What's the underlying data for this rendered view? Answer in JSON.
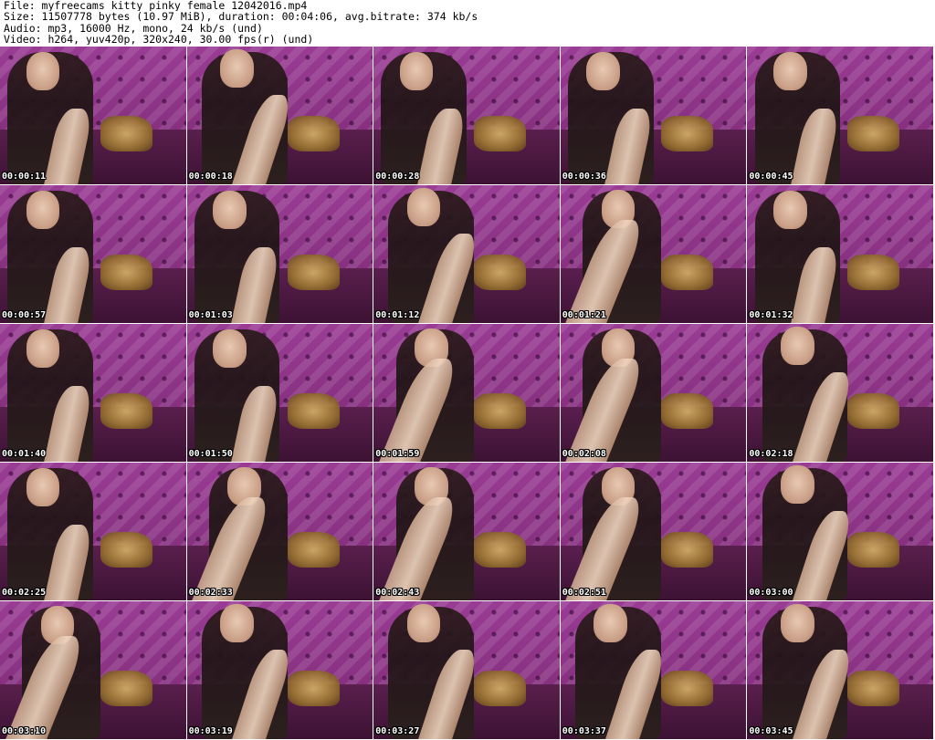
{
  "header": {
    "file_line": "File: myfreecams_kitty_pinky_female_12042016.mp4",
    "size_line": "Size: 11507778 bytes (10.97 MiB), duration: 00:04:06, avg.bitrate: 374 kb/s",
    "audio_line": "Audio: mp3, 16000 Hz, mono, 24 kb/s (und)",
    "video_line": "Video: h264, yuv420p, 320x240, 30.00 fps(r) (und)"
  },
  "thumbnails": [
    {
      "timestamp": "00:00:11"
    },
    {
      "timestamp": "00:00:18"
    },
    {
      "timestamp": "00:00:28"
    },
    {
      "timestamp": "00:00:36"
    },
    {
      "timestamp": "00:00:45"
    },
    {
      "timestamp": "00:00:57"
    },
    {
      "timestamp": "00:01:03"
    },
    {
      "timestamp": "00:01:12"
    },
    {
      "timestamp": "00:01:21"
    },
    {
      "timestamp": "00:01:32"
    },
    {
      "timestamp": "00:01:40"
    },
    {
      "timestamp": "00:01:50"
    },
    {
      "timestamp": "00:01:59"
    },
    {
      "timestamp": "00:02:08"
    },
    {
      "timestamp": "00:02:18"
    },
    {
      "timestamp": "00:02:25"
    },
    {
      "timestamp": "00:02:33"
    },
    {
      "timestamp": "00:02:43"
    },
    {
      "timestamp": "00:02:51"
    },
    {
      "timestamp": "00:03:00"
    },
    {
      "timestamp": "00:03:10"
    },
    {
      "timestamp": "00:03:19"
    },
    {
      "timestamp": "00:03:27"
    },
    {
      "timestamp": "00:03:37"
    },
    {
      "timestamp": "00:03:45"
    }
  ],
  "colors": {
    "background": "#ffffff",
    "header_text": "#000000",
    "timestamp_text": "#ffffff",
    "timestamp_outline": "#000000",
    "headboard": "#8c3486"
  }
}
